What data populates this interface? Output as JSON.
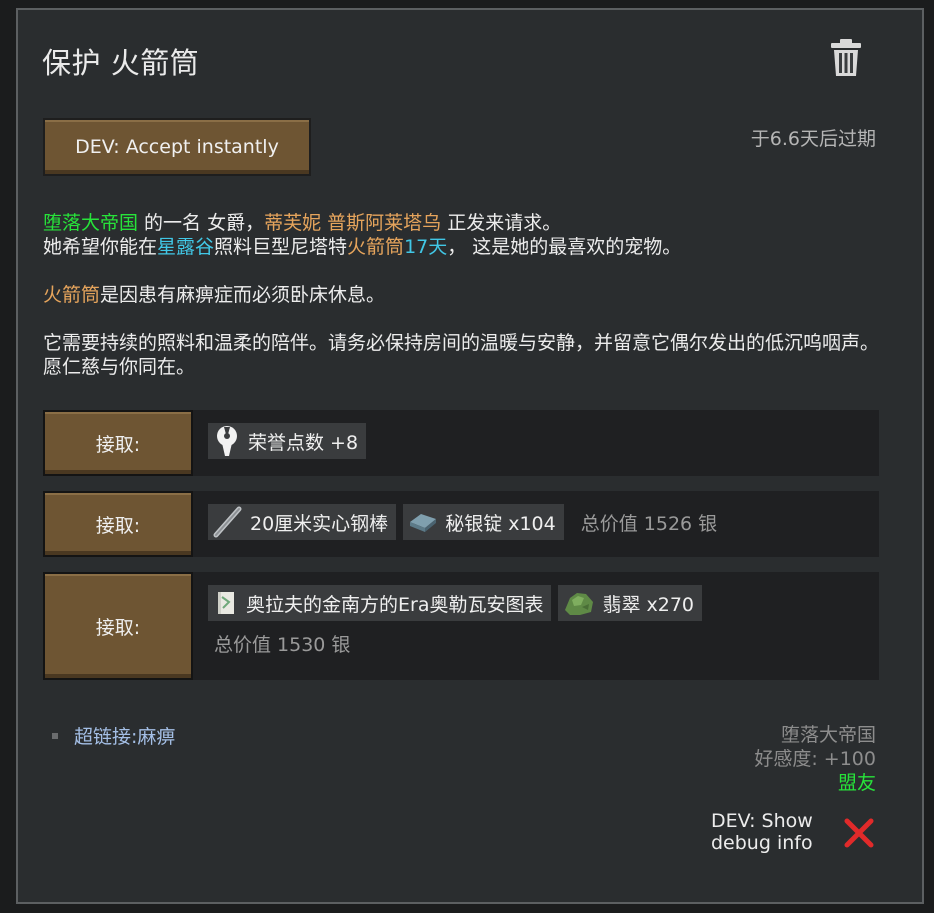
{
  "quest": {
    "title": "保护 火箭筒",
    "expiry": "于6.6天后过期",
    "dev_accept_label": "DEV: Accept instantly",
    "description": {
      "line1": {
        "faction": "堕落大帝国",
        "text1": " 的一名 女爵，",
        "person": "蒂芙妮 普斯阿莱塔乌",
        "text2": " 正发来请求。"
      },
      "line2": {
        "text1": "她希望你能在",
        "place": "星露谷",
        "text2": "照料巨型尼塔特",
        "animal": "火箭筒",
        "days": "17天",
        "text3": "， 这是她的最喜欢的宠物。"
      },
      "line3": {
        "animal": "火箭筒",
        "text": "是因患有麻痹症而必须卧床休息。"
      },
      "line4": "它需要持续的照料和温柔的陪伴。请务必保持房间的温暖与安静，并留意它偶尔发出的低沉呜咽声。愿仁慈与你同在。"
    }
  },
  "rewards": [
    {
      "accept_label": "接取:",
      "items": [
        {
          "icon": "honor-icon",
          "label": "荣誉点数 +8"
        }
      ]
    },
    {
      "accept_label": "接取:",
      "items": [
        {
          "icon": "steel-bar-icon",
          "label": "20厘米实心钢棒"
        },
        {
          "icon": "ingot-icon",
          "label": "秘银锭 x104"
        }
      ],
      "total": "总价值 1526 银"
    },
    {
      "accept_label": "接取:",
      "items": [
        {
          "icon": "book-icon",
          "label": "奥拉夫的金南方的Era奥勒瓦安图表"
        },
        {
          "icon": "jade-icon",
          "label": "翡翠 x270"
        }
      ],
      "total": "总价值 1530 银"
    }
  ],
  "footer": {
    "hyperlink_prefix": "超链接:",
    "hyperlink_target": "麻痹",
    "faction_name": "堕落大帝国",
    "goodwill": "好感度: +100",
    "relation": "盟友",
    "dev_debug_label": "DEV: Show debug info"
  },
  "colors": {
    "faction_green": "#27e33a",
    "person_orange": "#e5a45c",
    "place_cyan": "#41c7e6",
    "button_brown": "#6e5533",
    "close_red": "#e12a2a"
  }
}
